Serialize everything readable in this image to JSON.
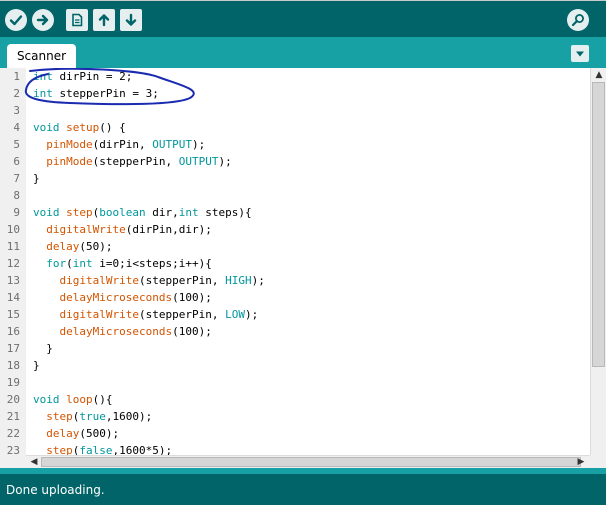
{
  "toolbar": {
    "buttons": [
      {
        "name": "verify",
        "icon": "check-icon"
      },
      {
        "name": "upload",
        "icon": "arrow-right-icon"
      },
      {
        "name": "new",
        "icon": "document-icon"
      },
      {
        "name": "open",
        "icon": "arrow-up-icon"
      },
      {
        "name": "save",
        "icon": "arrow-down-icon"
      },
      {
        "name": "serial-monitor",
        "icon": "magnifier-icon"
      }
    ]
  },
  "tab": {
    "label": "Scanner"
  },
  "editor": {
    "lines": [
      {
        "n": "1",
        "code": "int dirPin = 2;"
      },
      {
        "n": "2",
        "code": "int stepperPin = 3;"
      },
      {
        "n": "3",
        "code": ""
      },
      {
        "n": "4",
        "code": "void setup() {"
      },
      {
        "n": "5",
        "code": "  pinMode(dirPin, OUTPUT);"
      },
      {
        "n": "6",
        "code": "  pinMode(stepperPin, OUTPUT);"
      },
      {
        "n": "7",
        "code": "}"
      },
      {
        "n": "8",
        "code": ""
      },
      {
        "n": "9",
        "code": "void step(boolean dir,int steps){"
      },
      {
        "n": "10",
        "code": "  digitalWrite(dirPin,dir);"
      },
      {
        "n": "11",
        "code": "  delay(50);"
      },
      {
        "n": "12",
        "code": "  for(int i=0;i<steps;i++){"
      },
      {
        "n": "13",
        "code": "    digitalWrite(stepperPin, HIGH);"
      },
      {
        "n": "14",
        "code": "    delayMicroseconds(100);"
      },
      {
        "n": "15",
        "code": "    digitalWrite(stepperPin, LOW);"
      },
      {
        "n": "16",
        "code": "    delayMicroseconds(100);"
      },
      {
        "n": "17",
        "code": "  }"
      },
      {
        "n": "18",
        "code": "}"
      },
      {
        "n": "19",
        "code": ""
      },
      {
        "n": "20",
        "code": "void loop(){"
      },
      {
        "n": "21",
        "code": "  step(true,1600);"
      },
      {
        "n": "22",
        "code": "  delay(500);"
      },
      {
        "n": "23",
        "code": "  step(false,1600*5);"
      }
    ]
  },
  "status": {
    "text": "Done uploading."
  },
  "colors": {
    "toolbar": "#006468",
    "tabbar": "#17a1a5",
    "keyword": "#00979c",
    "function": "#d35400",
    "annotation": "#1a2bb0"
  }
}
